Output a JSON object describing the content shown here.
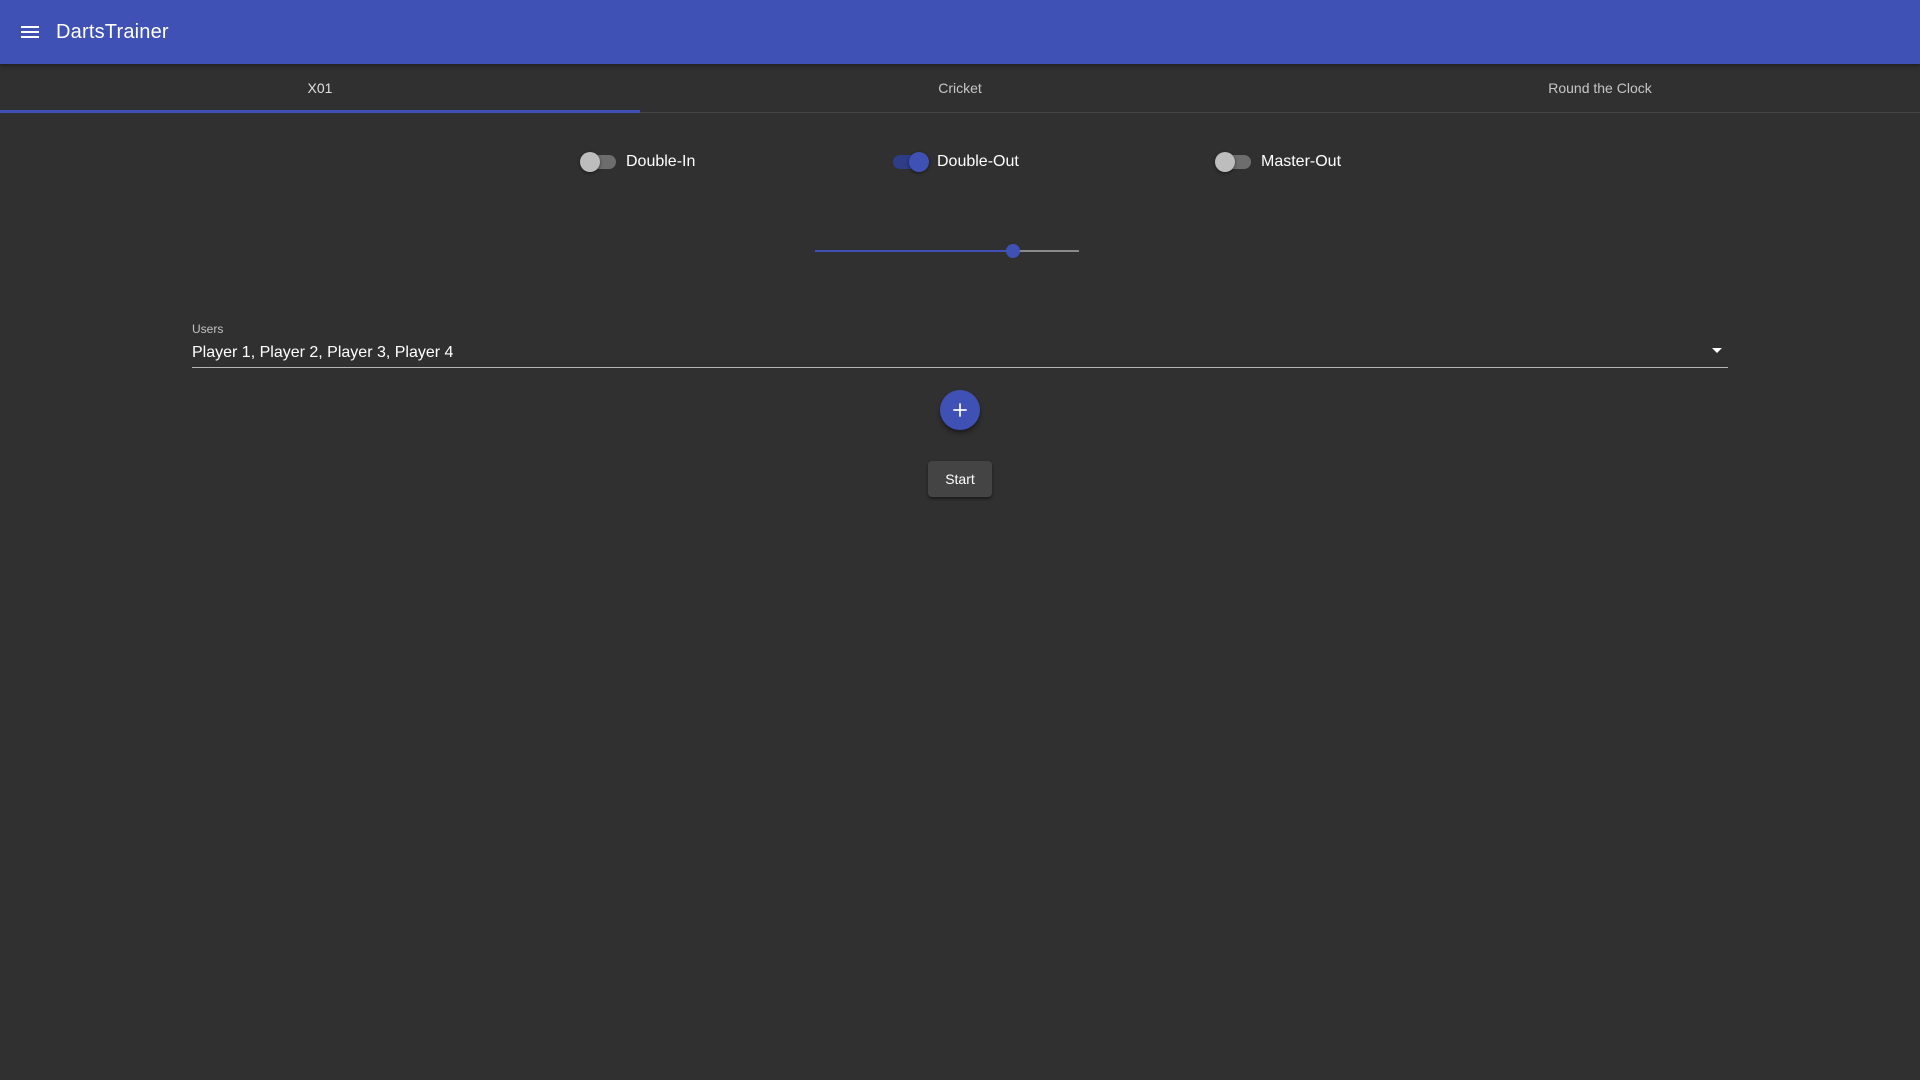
{
  "app": {
    "title": "DartsTrainer",
    "menu_icon": "menu-icon"
  },
  "tabs": [
    {
      "label": "X01",
      "active": true
    },
    {
      "label": "Cricket",
      "active": false
    },
    {
      "label": "Round the Clock",
      "active": false
    }
  ],
  "options": [
    {
      "label": "Double-In",
      "checked": false
    },
    {
      "label": "Double-Out",
      "checked": true
    },
    {
      "label": "Master-Out",
      "checked": false
    }
  ],
  "slider": {
    "value_fraction": 0.75
  },
  "users_select": {
    "label": "Users",
    "value": "Player 1, Player 2, Player 3, Player 4"
  },
  "add_button": {
    "icon": "plus-icon"
  },
  "start_button": {
    "label": "Start"
  },
  "colors": {
    "primary": "#3f51b5",
    "background": "#303030"
  }
}
